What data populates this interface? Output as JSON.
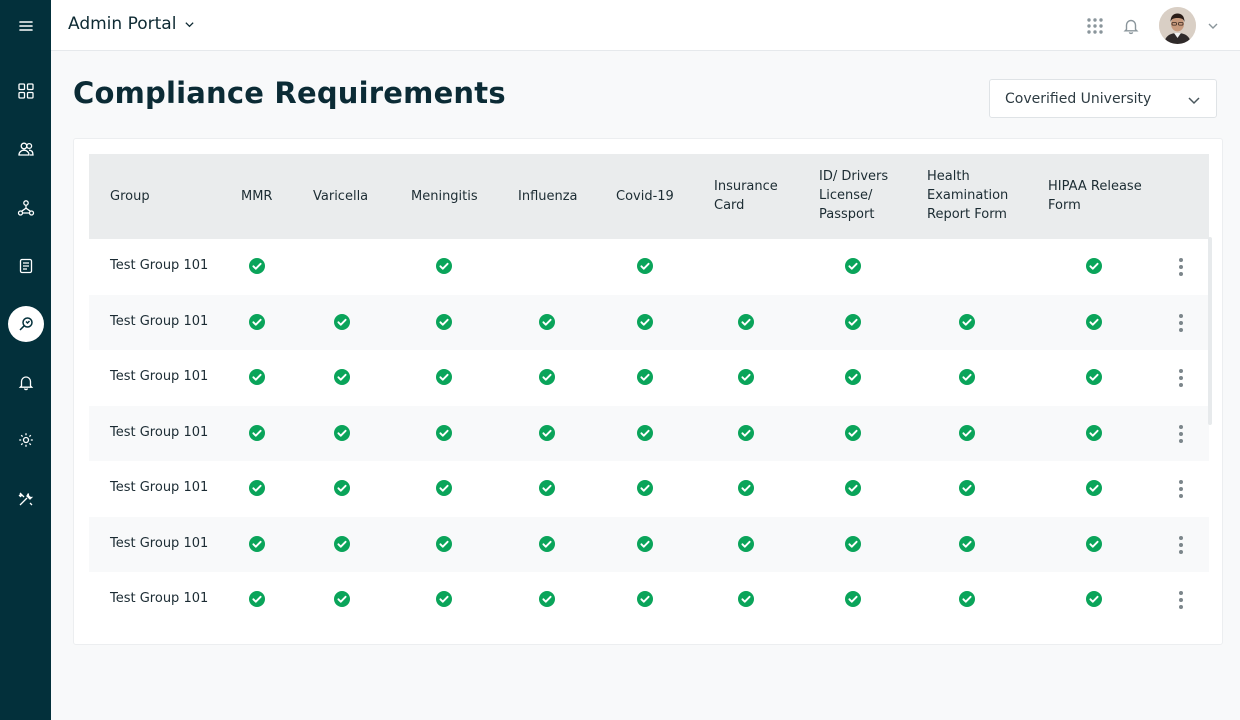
{
  "header": {
    "app_title": "Admin Portal"
  },
  "sidebar": {
    "items": [
      {
        "icon": "menu-icon"
      },
      {
        "icon": "dashboard-icon"
      },
      {
        "icon": "users-icon"
      },
      {
        "icon": "hierarchy-icon"
      },
      {
        "icon": "document-icon"
      },
      {
        "icon": "search-icon",
        "active": true
      },
      {
        "icon": "bell-icon"
      },
      {
        "icon": "gear-icon"
      },
      {
        "icon": "tools-icon"
      }
    ]
  },
  "page": {
    "title": "Compliance Requirements"
  },
  "filter": {
    "selected": "Coverified University"
  },
  "table": {
    "columns": [
      "Group",
      "MMR",
      "Varicella",
      "Meningitis",
      "Influenza",
      "Covid-19",
      "Insurance Card",
      "ID/ Drivers License/ Passport",
      "Health Examination Report Form",
      "HIPAA Release Form"
    ],
    "rows": [
      {
        "group": "Test Group 101",
        "checks": [
          true,
          false,
          true,
          false,
          true,
          false,
          true,
          false,
          true
        ]
      },
      {
        "group": "Test Group 101",
        "checks": [
          true,
          true,
          true,
          true,
          true,
          true,
          true,
          true,
          true
        ]
      },
      {
        "group": "Test Group 101",
        "checks": [
          true,
          true,
          true,
          true,
          true,
          true,
          true,
          true,
          true
        ]
      },
      {
        "group": "Test Group 101",
        "checks": [
          true,
          true,
          true,
          true,
          true,
          true,
          true,
          true,
          true
        ]
      },
      {
        "group": "Test Group 101",
        "checks": [
          true,
          true,
          true,
          true,
          true,
          true,
          true,
          true,
          true
        ]
      },
      {
        "group": "Test Group 101",
        "checks": [
          true,
          true,
          true,
          true,
          true,
          true,
          true,
          true,
          true
        ]
      },
      {
        "group": "Test Group 101",
        "checks": [
          true,
          true,
          true,
          true,
          true,
          true,
          true,
          true,
          true
        ]
      }
    ]
  },
  "colors": {
    "sidebar_bg": "#03303b",
    "check_green": "#0aa45a",
    "header_row_bg": "#eaeced"
  }
}
